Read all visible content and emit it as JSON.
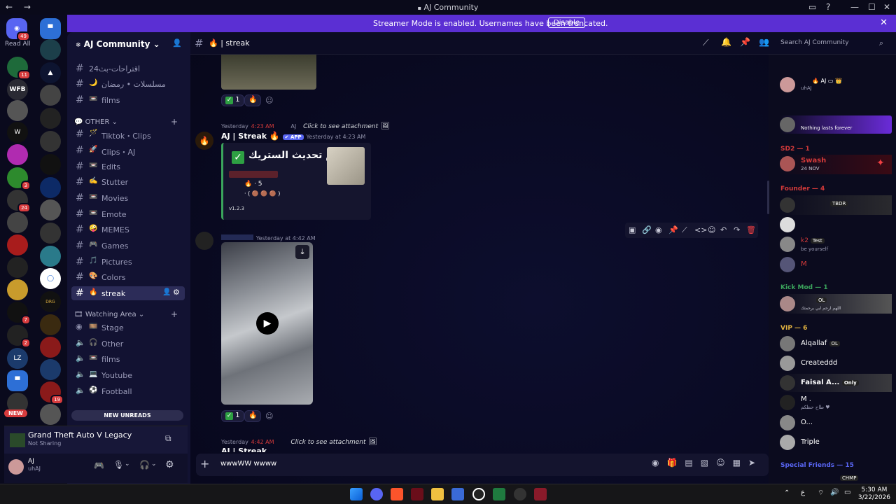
{
  "window": {
    "title": "AJ Community",
    "nav": "← →"
  },
  "guilds": {
    "read_all": "Read All",
    "dm_badge": "49",
    "badges": [
      "11",
      "3",
      "24",
      "7",
      "2",
      "19"
    ],
    "new_label": "NEW"
  },
  "banner": {
    "text": "Streamer Mode is enabled. Usernames have been truncated.",
    "button": "Disable"
  },
  "server": {
    "name": "AJ Community"
  },
  "channels_top": [
    {
      "emoji": "",
      "name": "اقتراحات-بث24"
    },
    {
      "emoji": "🌙",
      "name": "مسلسلات • رمضان"
    },
    {
      "emoji": "📼",
      "name": "films"
    }
  ],
  "category_other": "OTHER",
  "channels_other": [
    {
      "emoji": "🪄",
      "name": "Tiktok・Clips"
    },
    {
      "emoji": "🚀",
      "name": "Clips・AJ"
    },
    {
      "emoji": "📼",
      "name": "Edits"
    },
    {
      "emoji": "✍️",
      "name": "Stutter"
    },
    {
      "emoji": "📼",
      "name": "Movies"
    },
    {
      "emoji": "📼",
      "name": "Emote"
    },
    {
      "emoji": "🤪",
      "name": "MEMES"
    },
    {
      "emoji": "🎮",
      "name": "Games"
    },
    {
      "emoji": "🎵",
      "name": "Pictures"
    },
    {
      "emoji": "🎨",
      "name": "Colors"
    },
    {
      "emoji": "🔥",
      "name": "streak"
    }
  ],
  "category_watching": "Watching Area",
  "voice_channels": [
    {
      "emoji": "🎞️",
      "name": "Stage"
    },
    {
      "emoji": "🎧",
      "name": "Other"
    },
    {
      "emoji": "📼",
      "name": "films"
    },
    {
      "emoji": "💻",
      "name": "Youtube"
    },
    {
      "emoji": "⚽",
      "name": "Football"
    }
  ],
  "new_unreads": "NEW UNREADS",
  "activity": {
    "game": "Grand Theft Auto V Legacy",
    "status": "Not Sharing"
  },
  "user": {
    "name": "AJ",
    "tag": "uhAJ"
  },
  "channel_header": {
    "name": "streak",
    "search_placeholder": "Search AJ Community"
  },
  "messages": {
    "reaction_count": "1",
    "reply_line": {
      "ts": "Yesterday",
      "time": "4:23 AM",
      "user": "AJ",
      "text": "Click to see attachment"
    },
    "bot": {
      "name": "AJ | Streak",
      "badge": "✔ APP",
      "time": "Yesterday at 4:23 AM"
    },
    "embed": {
      "title": "تم تحديث الستريك •",
      "count": "· 5",
      "slots": "· ( 🟤 🟤 🟤 )",
      "version": "v1.2.3"
    },
    "video_msg": {
      "time": "Yesterday at 4:42 AM"
    },
    "reply_line2": {
      "ts": "Yesterday",
      "time": "4:42 AM",
      "text": "Click to see attachment"
    },
    "bot2_name": "AJ | Streak"
  },
  "composer": {
    "value": "wwwWW wwww"
  },
  "members": {
    "top": [
      {
        "name": "AJ",
        "status": "uhAJ",
        "color": "#ffffff"
      },
      {
        "name": "",
        "status": "Nothing lasts forever",
        "color": "#ffffff"
      }
    ],
    "groups": [
      {
        "label": "SD2 — 1",
        "color": "#d43a3a"
      },
      {
        "label": "Founder — 4",
        "color": "#d43a3a"
      },
      {
        "label": "Kick Mod — 1",
        "color": "#3ba55c"
      },
      {
        "label": "VIP — 6",
        "color": "#e3b341"
      },
      {
        "label": "Special Friends — 15",
        "color": "#5865f2"
      }
    ],
    "sd2": [
      {
        "name": "Swash",
        "status": "24 NOV"
      }
    ],
    "founder": [
      {
        "name": "",
        "tag": "TBDR",
        "status": ""
      },
      {
        "name": "",
        "tag": "",
        "status": ""
      },
      {
        "name": "k2",
        "tag": "Test",
        "status": "be yourself"
      },
      {
        "name": "M",
        "tag": "",
        "status": ""
      }
    ],
    "kickmod": [
      {
        "name": "",
        "tag": "OL",
        "status": "اللهم ارحم ابي برحمتك"
      }
    ],
    "vip": [
      {
        "name": "Alqallaf",
        "tag": "OL"
      },
      {
        "name": "Createddd",
        "tag": ""
      },
      {
        "name": "Faisal A...",
        "tag": "Only"
      },
      {
        "name": "M .",
        "tag": "",
        "status": "طاح حظكم ♥"
      },
      {
        "name": "O...",
        "tag": ""
      },
      {
        "name": "Triple",
        "tag": ""
      }
    ],
    "special_tag": "CHMP"
  },
  "taskbar": {
    "time": "5:30 AM",
    "date": "3/22/2026",
    "lang": "ع"
  },
  "colors": {
    "banner": "#5b2fd3",
    "accent": "#5865f2",
    "green": "#3ba55c",
    "red": "#d83c3e"
  }
}
